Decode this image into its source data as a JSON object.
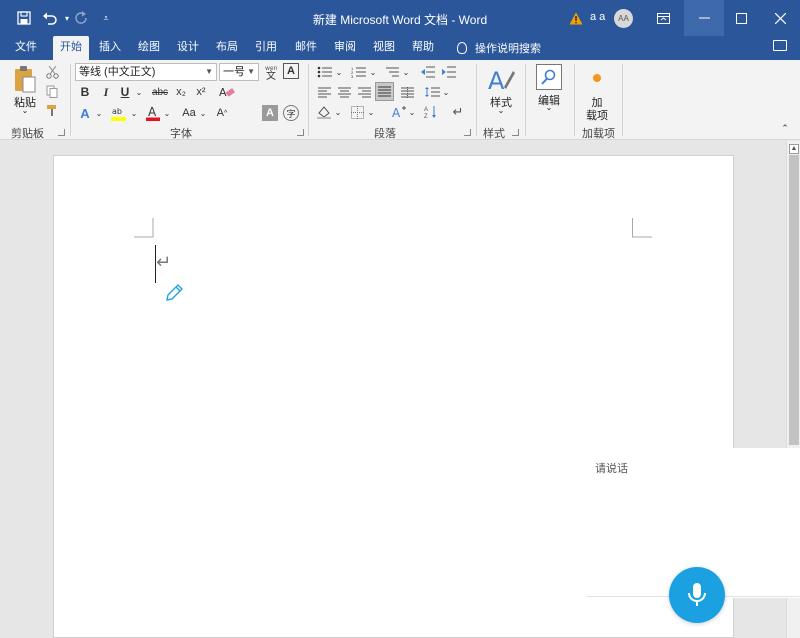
{
  "app": {
    "title": "新建 Microsoft Word 文档  -  Word",
    "user_initials": "a a",
    "avatar": "AA"
  },
  "tabs": [
    {
      "label": "文件"
    },
    {
      "label": "开始"
    },
    {
      "label": "插入"
    },
    {
      "label": "绘图"
    },
    {
      "label": "设计"
    },
    {
      "label": "布局"
    },
    {
      "label": "引用"
    },
    {
      "label": "邮件"
    },
    {
      "label": "审阅"
    },
    {
      "label": "视图"
    },
    {
      "label": "帮助"
    }
  ],
  "tell_me": "操作说明搜索",
  "ribbon": {
    "clipboard": {
      "paste": "粘贴",
      "group": "剪贴板"
    },
    "font": {
      "font_name": "等线 (中文正文)",
      "font_size": "一号",
      "group": "字体",
      "bold": "B",
      "italic": "I",
      "underline": "U",
      "strike": "abc",
      "subscript": "x₂",
      "superscript": "x²",
      "change_case": "Aa"
    },
    "paragraph": {
      "group": "段落"
    },
    "styles": {
      "label": "样式",
      "group": "样式"
    },
    "editing": {
      "label": "编辑"
    },
    "addins": {
      "label_line1": "加",
      "label_line2": "载项",
      "group": "加载项"
    }
  },
  "voice": {
    "prompt": "请说话"
  },
  "colors": {
    "accent": "#2b579a",
    "mic": "#1ba1e2",
    "warning": "#f2a100",
    "addin_dot": "#f7941d"
  }
}
